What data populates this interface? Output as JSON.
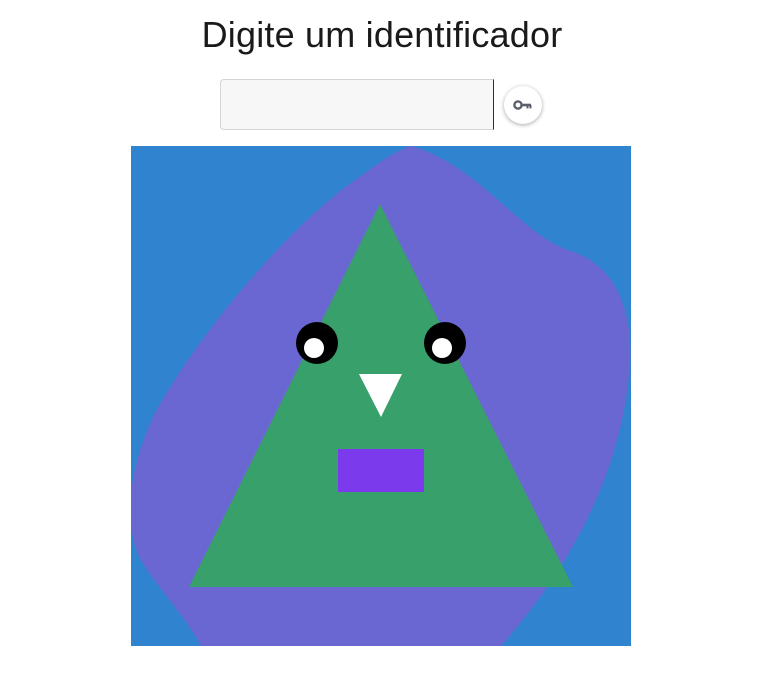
{
  "header": {
    "title": "Digite um identificador"
  },
  "identifier_input": {
    "value": "",
    "placeholder": ""
  },
  "submit_button": {
    "icon": "key-icon"
  },
  "avatar": {
    "colors": {
      "background": "#3083CF",
      "blob": "#6A67D2",
      "body": "#38A06A",
      "eye_outer": "#000000",
      "eye_inner": "#FFFFFF",
      "nose": "#FFFFFF",
      "mouth": "#7B3AEC"
    }
  }
}
